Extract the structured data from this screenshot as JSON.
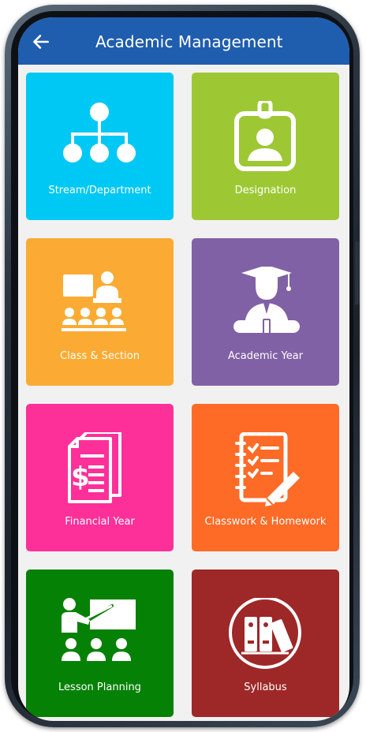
{
  "app_bar": {
    "title": "Academic Management",
    "background": "#1f5dae",
    "back_icon": "arrow-left-icon"
  },
  "tiles": [
    {
      "label": "Stream/Department",
      "color": "#00c8f4",
      "icon": "hierarchy-icon"
    },
    {
      "label": "Designation",
      "color": "#9dc834",
      "icon": "id-badge-icon"
    },
    {
      "label": "Class & Section",
      "color": "#fbab33",
      "icon": "classroom-icon"
    },
    {
      "label": "Academic Year",
      "color": "#8161a5",
      "icon": "graduate-icon"
    },
    {
      "label": "Financial Year",
      "color": "#fd3099",
      "icon": "invoice-dollar-icon"
    },
    {
      "label": "Classwork & Homework",
      "color": "#fe6b27",
      "icon": "checklist-notebook-icon"
    },
    {
      "label": "Lesson Planning",
      "color": "#058105",
      "icon": "teacher-board-icon"
    },
    {
      "label": "Syllabus",
      "color": "#9e2828",
      "icon": "books-icon"
    }
  ]
}
